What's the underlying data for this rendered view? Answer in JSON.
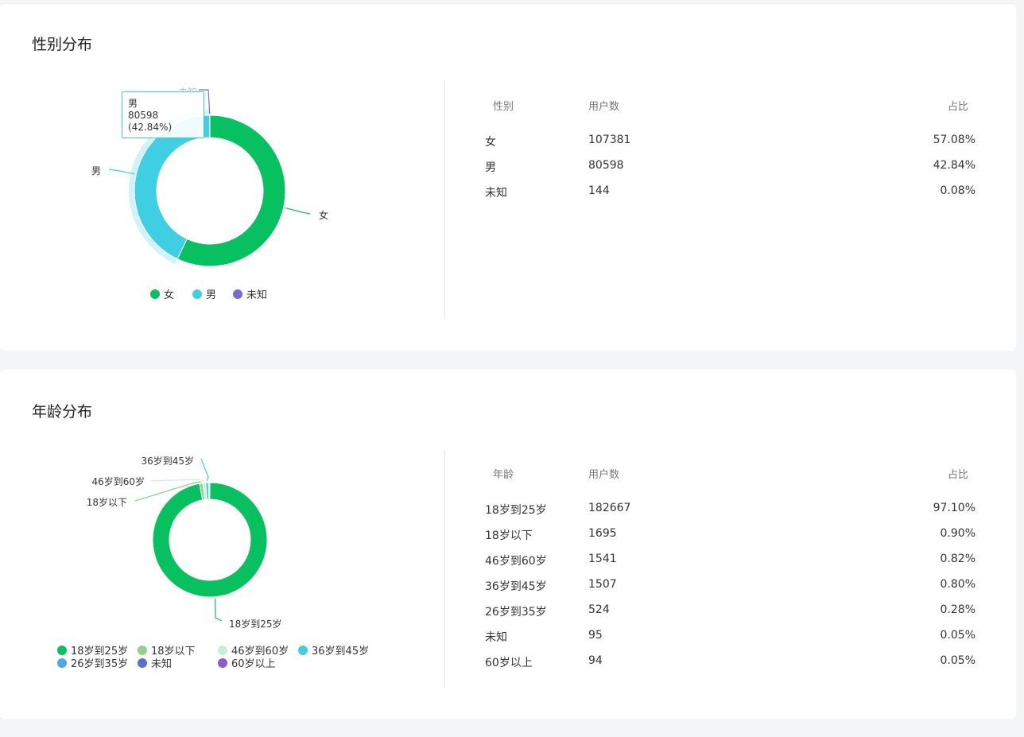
{
  "gender": {
    "title": "性别分布",
    "table_headers": [
      "性别",
      "用户数",
      "占比"
    ],
    "tooltip": {
      "name": "男",
      "value": "80598 (42.84%)"
    }
  },
  "age": {
    "title": "年龄分布",
    "table_headers": [
      "年龄",
      "用户数",
      "占比"
    ]
  },
  "chart_data": [
    {
      "type": "pie",
      "title": "性别分布",
      "legend_position": "bottom",
      "slices": [
        {
          "name": "女",
          "value": 107381,
          "percent": "57.08%",
          "color": "#07c160"
        },
        {
          "name": "男",
          "value": 80598,
          "percent": "42.84%",
          "color": "#3fcfe3"
        },
        {
          "name": "未知",
          "value": 144,
          "percent": "0.08%",
          "color": "#6b70d6"
        }
      ]
    },
    {
      "type": "pie",
      "title": "年龄分布",
      "legend_position": "bottom",
      "slices": [
        {
          "name": "18岁到25岁",
          "value": 182667,
          "percent": "97.10%",
          "color": "#07c160"
        },
        {
          "name": "18岁以下",
          "value": 1695,
          "percent": "0.90%",
          "color": "#8fd18c"
        },
        {
          "name": "46岁到60岁",
          "value": 1541,
          "percent": "0.82%",
          "color": "#c8efd7"
        },
        {
          "name": "36岁到45岁",
          "value": 1507,
          "percent": "0.80%",
          "color": "#3fcfe3"
        },
        {
          "name": "26岁到35岁",
          "value": 524,
          "percent": "0.28%",
          "color": "#4ea7ea"
        },
        {
          "name": "未知",
          "value": 95,
          "percent": "0.05%",
          "color": "#5b6fd0"
        },
        {
          "name": "60岁以上",
          "value": 94,
          "percent": "0.05%",
          "color": "#8a5cd1"
        }
      ],
      "legend_order": [
        "18岁到25岁",
        "18岁以下",
        "46岁到60岁",
        "36岁到45岁",
        "26岁到35岁",
        "未知",
        "60岁以上"
      ]
    }
  ]
}
